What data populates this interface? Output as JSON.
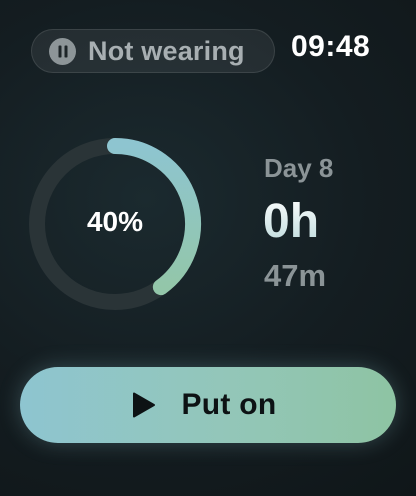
{
  "status": {
    "icon": "pause-icon",
    "label": "Not wearing"
  },
  "clock": {
    "time": "09:48"
  },
  "progress": {
    "percent_label": "40%",
    "value": 0.4,
    "track_color": "#2a3437",
    "arc_start_color": "#8ec5d0",
    "arc_end_color": "#93c6a9"
  },
  "session": {
    "day_label": "Day 8",
    "hours_label": "0h",
    "minutes_label": "47m"
  },
  "action": {
    "icon": "play-icon",
    "label": "Put on",
    "gradient_start": "#8ec5d0",
    "gradient_end": "#8ec4a3"
  }
}
